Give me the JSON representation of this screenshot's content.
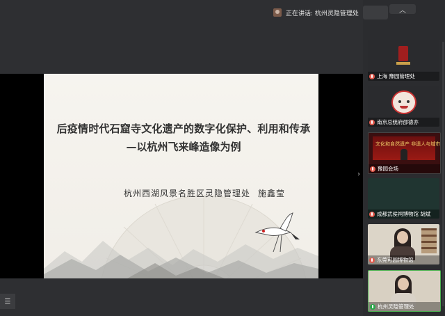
{
  "header": {
    "speaking_label": "正在讲话: 杭州灵隐管理处",
    "collapse_icon": "chevron-up-icon"
  },
  "slide": {
    "title_line1": "后疫情时代石窟寺文化遗产的数字化保护、利用和传承",
    "title_line2": "—以杭州飞来峰造像为例",
    "organization": "杭州西湖风景名胜区灵隐管理处",
    "author": "施鑫莹"
  },
  "participants": [
    {
      "name": "上海 豫园管理处",
      "mic": "muted"
    },
    {
      "name": "南京总统府邵德亦",
      "mic": "muted"
    },
    {
      "name": "豫园会场",
      "mic": "muted",
      "banner_text": "文化和自然遗产 非遗人与城市"
    },
    {
      "name": "成都武侯祠博物馆 胡斌",
      "mic": "muted"
    },
    {
      "name": "东莞可园博物馆",
      "mic": "muted"
    },
    {
      "name": "杭州灵隐管理处",
      "mic": "active"
    }
  ],
  "controls": {
    "sidebar_arrow": "›",
    "list_button_icon": "list-icon"
  }
}
